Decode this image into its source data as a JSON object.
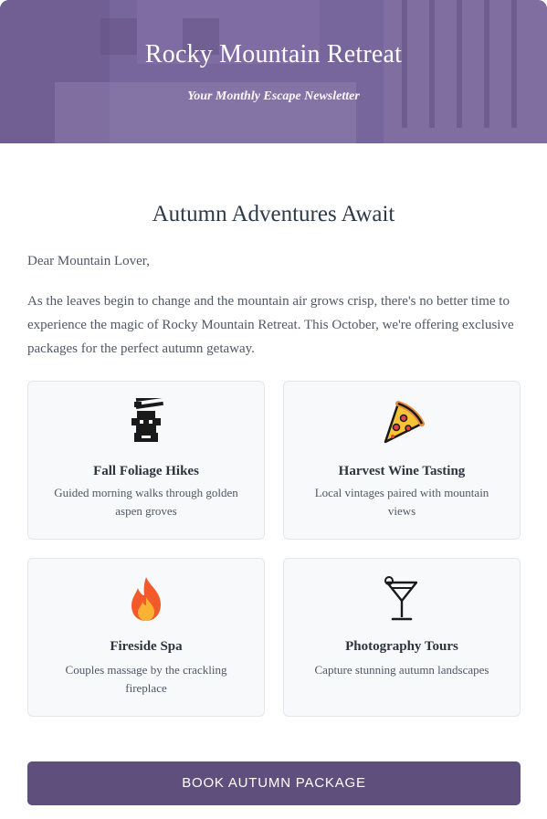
{
  "header": {
    "title": "Rocky Mountain Retreat",
    "subtitle": "Your Monthly Escape Newsletter",
    "colors": {
      "overlay": "#7a6a9e"
    }
  },
  "main": {
    "heading": "Autumn Adventures Await",
    "greeting": "Dear Mountain Lover,",
    "intro": "As the leaves begin to change and the mountain air grows crisp, there's no better time to experience the magic of Rocky Mountain Retreat. This October, we're offering exclusive packages for the perfect autumn getaway.",
    "features": [
      {
        "icon": "lantern-icon",
        "title": "Fall Foliage Hikes",
        "description": "Guided morning walks through golden aspen groves"
      },
      {
        "icon": "pizza-icon",
        "title": "Harvest Wine Tasting",
        "description": "Local vintages paired with mountain views"
      },
      {
        "icon": "fire-icon",
        "title": "Fireside Spa",
        "description": "Couples massage by the crackling fireplace"
      },
      {
        "icon": "cocktail-glass-icon",
        "title": "Photography Tours",
        "description": "Capture stunning autumn landscapes"
      }
    ]
  },
  "cta": {
    "label": "BOOK AUTUMN PACKAGE",
    "color": "#5f4f7d"
  }
}
